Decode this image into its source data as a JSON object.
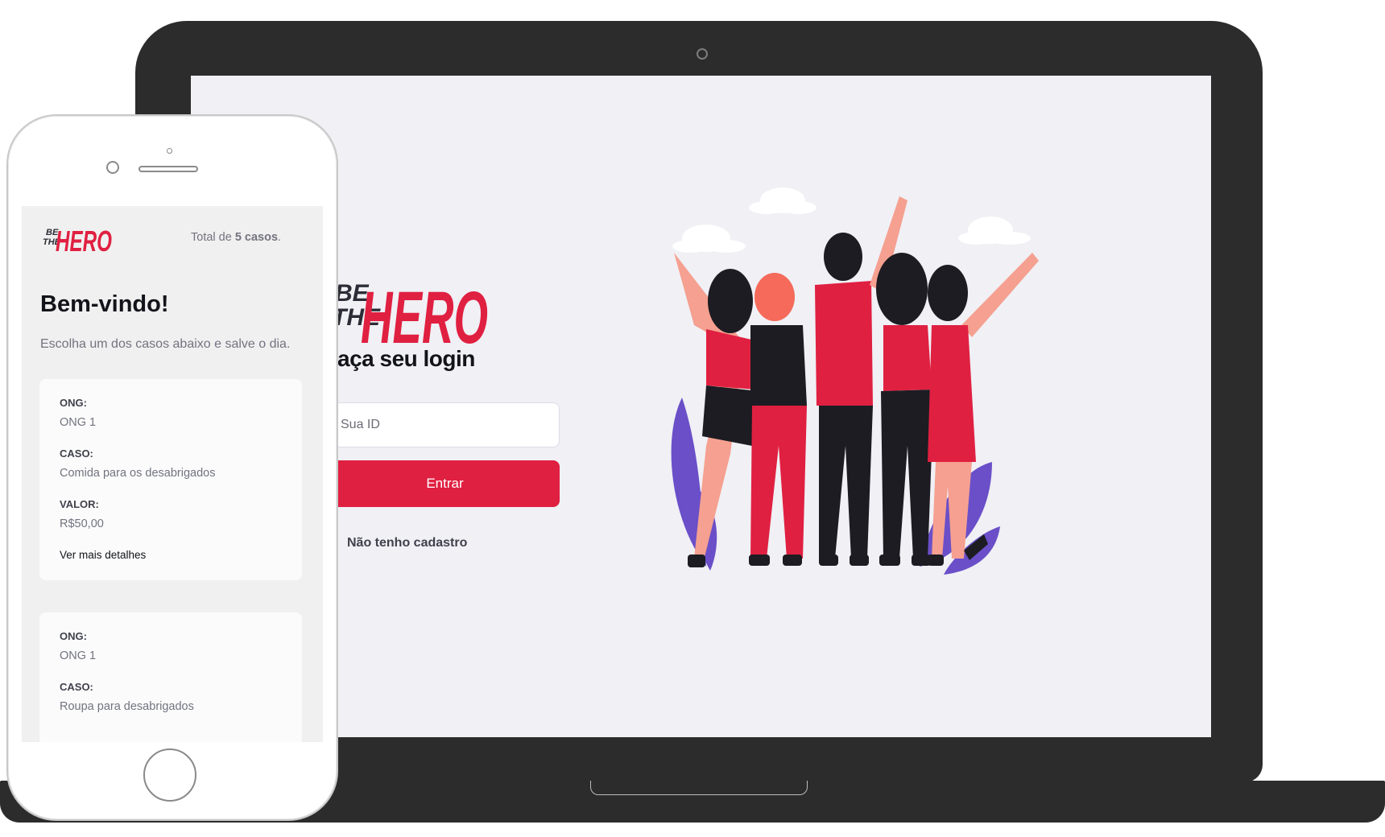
{
  "colors": {
    "brand_red": "#e02041",
    "background": "#f0f0f5",
    "text_dark": "#13131a",
    "text_muted": "#737380"
  },
  "logo": {
    "line1": "BE",
    "line2": "THE",
    "word": "HERO"
  },
  "laptop": {
    "login_title": "aça seu login",
    "id_placeholder": "Sua ID",
    "enter_label": "Entrar",
    "register_label": "Não tenho cadastro"
  },
  "phone": {
    "total_prefix": "Total de ",
    "total_count": "5 casos",
    "total_suffix": ".",
    "welcome_title": "Bem-vindo!",
    "welcome_subtitle": "Escolha um dos casos abaixo e salve o dia.",
    "cases": [
      {
        "ong_label": "ONG:",
        "ong": "ONG 1",
        "case_label": "CASO:",
        "case": "Comida para os desabrigados",
        "value_label": "VALOR:",
        "value": "R$50,00",
        "details_label": "Ver mais detalhes"
      },
      {
        "ong_label": "ONG:",
        "ong": "ONG 1",
        "case_label": "CASO:",
        "case": "Roupa para desabrigados"
      }
    ]
  },
  "icons": {
    "register": "log-in-icon",
    "illustration": "heroes-group-illustration"
  }
}
